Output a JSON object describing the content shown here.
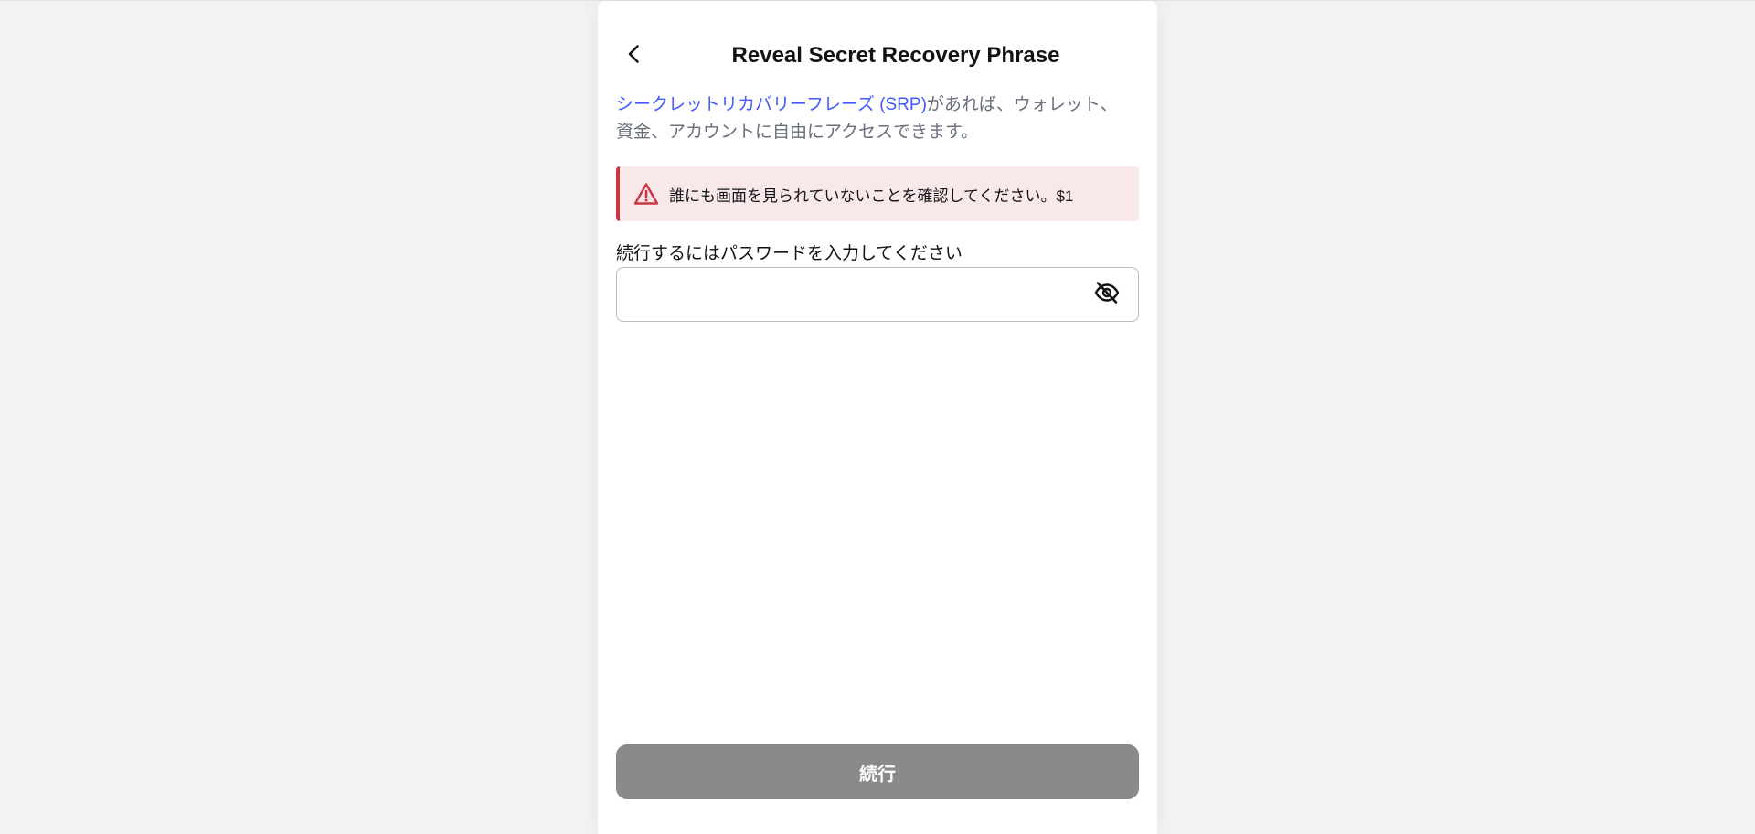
{
  "header": {
    "title": "Reveal Secret Recovery Phrase",
    "back_icon": "chevron-left-icon"
  },
  "intro": {
    "link_text": "シークレットリカバリーフレーズ (SRP)",
    "rest_text": "があれば、ウォレット、資金、アカウントに自由にアクセスできます。",
    "link_color": "#4459ff"
  },
  "warning": {
    "icon": "warning-triangle-icon",
    "text": "誰にも画面を見られていないことを確認してください。$1",
    "color": "#ca3542",
    "background": "#f9e8ea"
  },
  "password": {
    "label": "続行するにはパスワードを入力してください",
    "value": "",
    "placeholder": "",
    "toggle_icon": "eye-slash-icon"
  },
  "footer": {
    "continue_label": "続行",
    "button_color": "#8a8a8a"
  }
}
